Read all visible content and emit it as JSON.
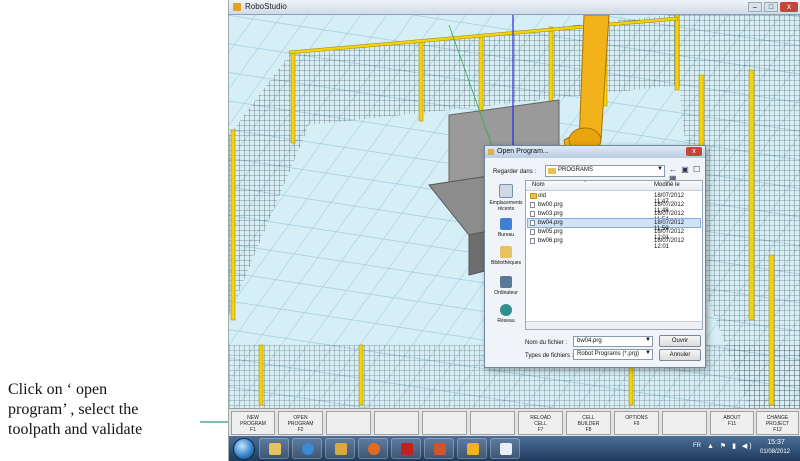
{
  "annotation": {
    "text_line1": "Click on ‘ open",
    "text_line2": "program’ , select the",
    "text_line3": "toolpath and  validate"
  },
  "window": {
    "title": "RoboStudio",
    "controls": {
      "minimize": "–",
      "maximize": "□",
      "close": "x"
    }
  },
  "dialog": {
    "title": "Open Program...",
    "close_label": "x",
    "look_in_label": "Regarder dans :",
    "look_in_value": "PROGRAMS",
    "nav_tools": "← ▣ ☐ ▦",
    "places": [
      {
        "label": "Emplacements récents",
        "icon": "recent-places-icon"
      },
      {
        "label": "Bureau",
        "icon": "desktop-icon"
      },
      {
        "label": "Bibliothèques",
        "icon": "libraries-icon"
      },
      {
        "label": "Ordinateur",
        "icon": "computer-icon"
      },
      {
        "label": "Réseau",
        "icon": "network-icon"
      }
    ],
    "columns": {
      "name": "Nom",
      "date": "Modifié le",
      "sort_indicator": "^"
    },
    "files": [
      {
        "name": "old",
        "date": "18/07/2012 11:47",
        "type": "folder"
      },
      {
        "name": "bw00.prg",
        "date": "18/07/2012 11:48",
        "type": "file"
      },
      {
        "name": "bw03.prg",
        "date": "18/07/2012 11:54",
        "type": "file"
      },
      {
        "name": "bw04.prg",
        "date": "18/07/2012 11:59",
        "type": "file",
        "selected": true
      },
      {
        "name": "bw05.prg",
        "date": "18/07/2012 12:01",
        "type": "file"
      },
      {
        "name": "bw06.prg",
        "date": "18/07/2012 12:01",
        "type": "file"
      }
    ],
    "file_name_label": "Nom du fichier :",
    "file_name_value": "bw04.prg",
    "file_type_label": "Types de fichiers :",
    "file_type_value": "Robot Programs (*.prg)",
    "open_button": "Ouvrir",
    "cancel_button": "Annuler"
  },
  "fkeys": [
    {
      "line1": "NEW",
      "line2": "PROGRAM",
      "line3": "F1"
    },
    {
      "line1": "OPEN",
      "line2": "PROGRAM",
      "line3": "F2"
    },
    {
      "line1": "",
      "line2": "",
      "line3": ""
    },
    {
      "line1": "",
      "line2": "",
      "line3": ""
    },
    {
      "line1": "",
      "line2": "",
      "line3": ""
    },
    {
      "line1": "",
      "line2": "",
      "line3": ""
    },
    {
      "line1": "RELOAD",
      "line2": "CELL",
      "line3": "F7"
    },
    {
      "line1": "CELL",
      "line2": "BUILDER",
      "line3": "F8"
    },
    {
      "line1": "OPTIONS",
      "line2": "",
      "line3": "F9"
    },
    {
      "line1": "",
      "line2": "",
      "line3": ""
    },
    {
      "line1": "ABOUT",
      "line2": "",
      "line3": "F11"
    },
    {
      "line1": "CHANGE",
      "line2": "PROJECT",
      "line3": "F12"
    }
  ],
  "taskbar": {
    "apps": [
      "explorer-icon",
      "internet-explorer-icon",
      "folder-icon",
      "media-player-icon",
      "acrobat-icon",
      "powerpoint-icon",
      "robot-app-icon",
      "document-icon"
    ],
    "language": "FR",
    "tray": "▲ ⚑ ▮ ◀)",
    "time": "15:37",
    "date": "01/08/2012"
  },
  "colors": {
    "robot": "#f2b21a",
    "fence_post": "#f5d20a",
    "floor_grid": "#bfe4f0",
    "selection": "#cfe3fb",
    "arrow": "#2aa072"
  }
}
